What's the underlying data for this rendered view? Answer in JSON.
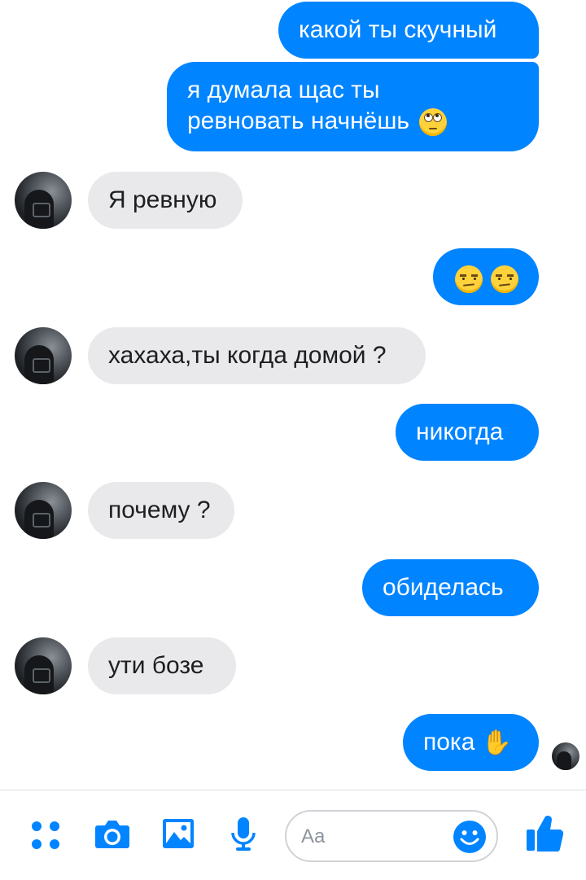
{
  "accent_color": "#0084ff",
  "incoming_color": "#e9e9eb",
  "messages": [
    {
      "direction": "out",
      "text": "какой ты скучный"
    },
    {
      "direction": "out",
      "line1": "я думала щас ты",
      "line2": "ревновать начнёшь",
      "emoji": "face-with-rolling-eyes"
    },
    {
      "direction": "in",
      "text": "Я ревную"
    },
    {
      "direction": "out",
      "emoji": [
        "unamused-face",
        "unamused-face"
      ]
    },
    {
      "direction": "in",
      "text": "хахаха,ты когда домой ?"
    },
    {
      "direction": "out",
      "text": "никогда"
    },
    {
      "direction": "in",
      "text": "почему ?"
    },
    {
      "direction": "out",
      "text": "обиделась"
    },
    {
      "direction": "in",
      "text": "ути бозе"
    },
    {
      "direction": "out",
      "text": "пока",
      "emoji": "waving-hand"
    }
  ],
  "composer": {
    "placeholder": "Aa",
    "icons": [
      "apps-icon",
      "camera-icon",
      "gallery-icon",
      "microphone-icon",
      "emoji-icon",
      "thumbs-up-icon"
    ]
  }
}
